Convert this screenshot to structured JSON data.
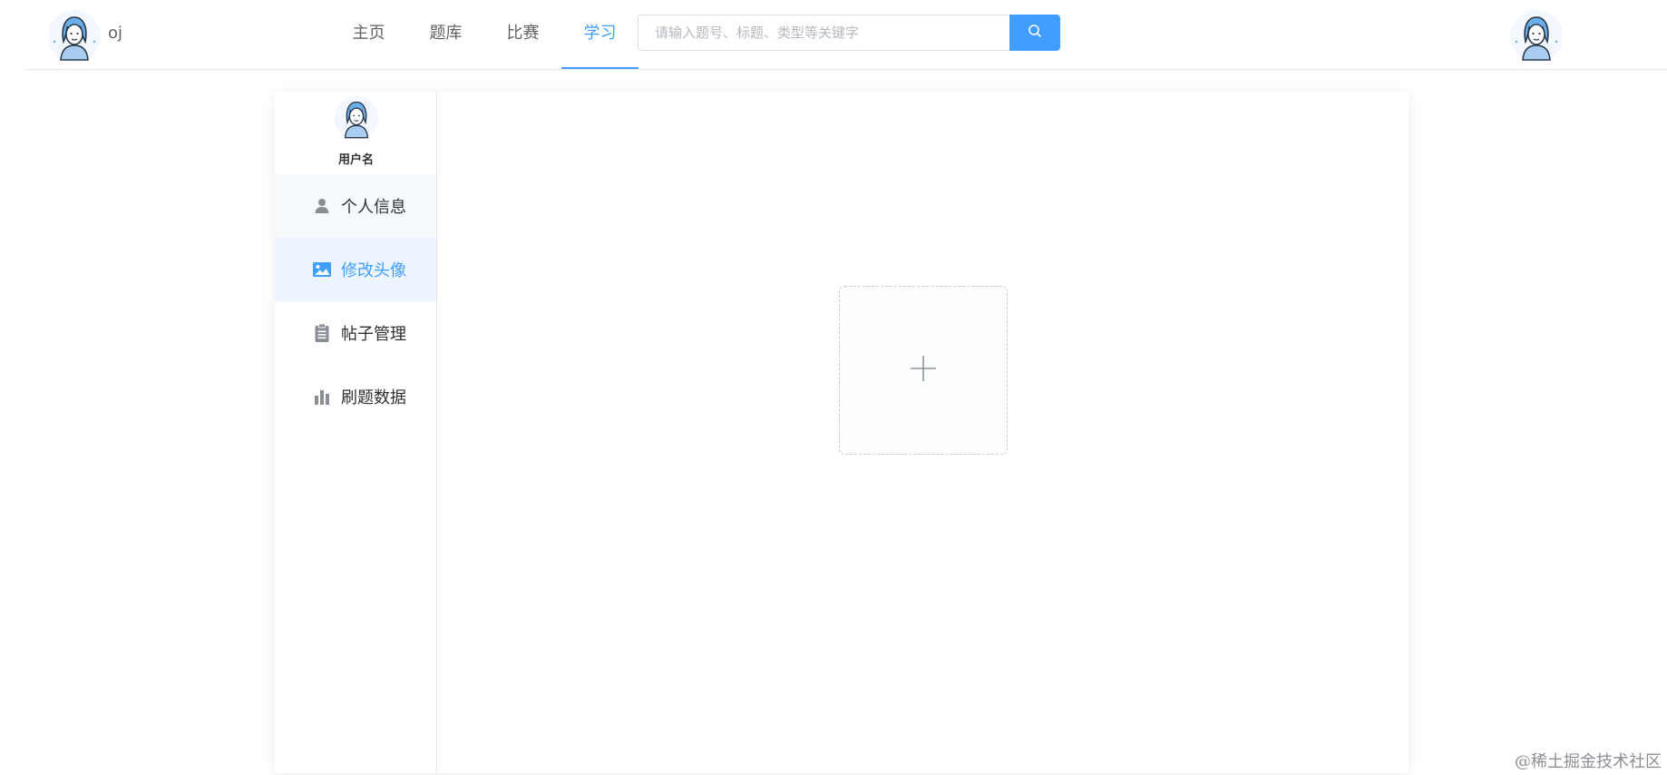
{
  "header": {
    "logo_text": "oj",
    "nav": [
      {
        "label": "主页"
      },
      {
        "label": "题库"
      },
      {
        "label": "比赛"
      },
      {
        "label": "学习"
      }
    ],
    "active_nav_index": 3,
    "search": {
      "placeholder": "请输入题号、标题、类型等关键字",
      "value": ""
    }
  },
  "sidebar": {
    "username": "用户名",
    "menu": [
      {
        "label": "个人信息",
        "icon": "user-icon"
      },
      {
        "label": "修改头像",
        "icon": "picture-icon"
      },
      {
        "label": "帖子管理",
        "icon": "clipboard-icon"
      },
      {
        "label": "刷题数据",
        "icon": "bar-chart-icon"
      }
    ],
    "active_menu_index": 1
  },
  "watermark": "@稀土掘金技术社区",
  "colors": {
    "accent": "#409eff",
    "border": "#e6e6e6",
    "active_bg": "#ecf5ff",
    "text": "#303133",
    "muted": "#606266"
  }
}
